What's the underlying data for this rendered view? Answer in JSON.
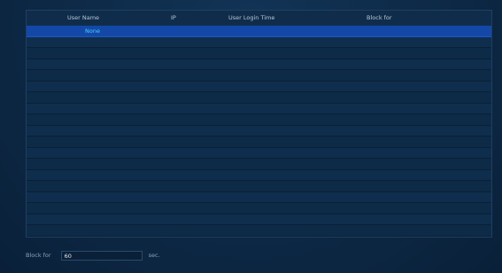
{
  "table": {
    "columns": [
      {
        "key": "user_name",
        "label": "User Name"
      },
      {
        "key": "ip",
        "label": "IP"
      },
      {
        "key": "login_time",
        "label": "User Login Time"
      },
      {
        "key": "block_for",
        "label": "Block for"
      }
    ],
    "rows": [
      {
        "user_name": "None",
        "ip": "",
        "login_time": "",
        "block_for": "",
        "selected": true
      }
    ],
    "empty_row_count": 18
  },
  "footer": {
    "block_label": "Block for",
    "block_value": "60",
    "unit": "sec."
  }
}
